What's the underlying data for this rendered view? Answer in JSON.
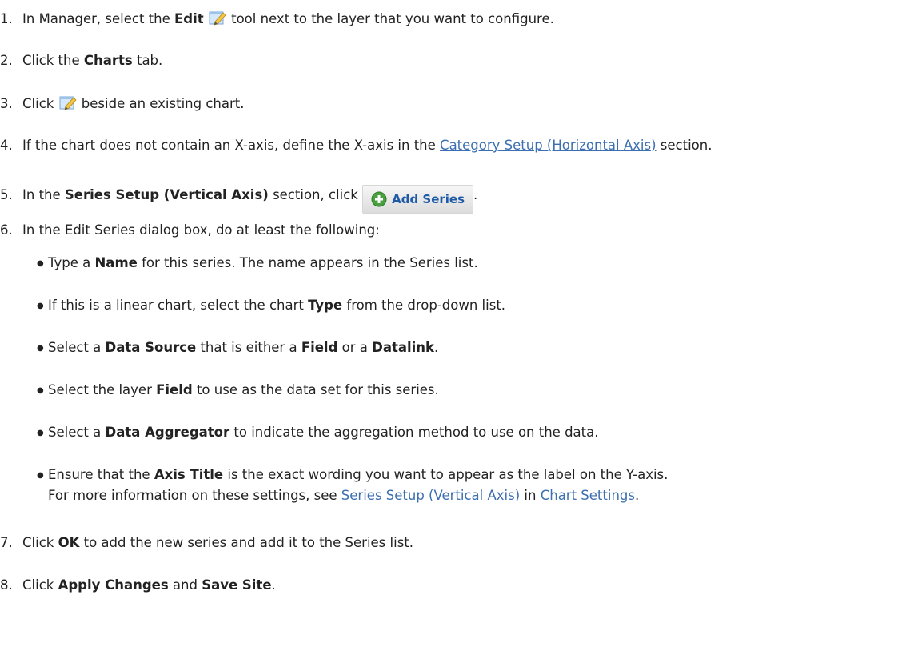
{
  "steps": [
    {
      "n": "1.",
      "a": "In Manager, select the ",
      "b": "Edit",
      "c": " tool next to the layer that you want to configure."
    },
    {
      "n": "2.",
      "a": "Click the ",
      "b": "Charts",
      "c": " tab."
    },
    {
      "n": "3.",
      "a": "Click ",
      "c": " beside an existing chart."
    },
    {
      "n": "4.",
      "a": "If the chart does not contain an X-axis, define the X-axis in the ",
      "link": "Category Setup (Horizontal Axis)",
      "c": " section."
    },
    {
      "n": "5.",
      "a": "In the ",
      "b": "Series Setup (Vertical Axis)",
      "c": " section, click ",
      "button": "Add Series",
      "d": "."
    },
    {
      "n": "6.",
      "a": "In the Edit Series dialog box, do at least the following:"
    },
    {
      "n": "7.",
      "a": "Click ",
      "b": "OK",
      "c": " to add the new series and add it to the Series list."
    },
    {
      "n": "8.",
      "a": "Click ",
      "b": "Apply Changes",
      "c": " and ",
      "b2": "Save Site",
      "d": "."
    }
  ],
  "bullets": [
    {
      "a": "Type a ",
      "b": "Name",
      "c": " for this series. The name appears in the Series list."
    },
    {
      "a": "If this is a linear chart, select the chart ",
      "b": "Type",
      "c": " from the drop-down list."
    },
    {
      "a": "Select a ",
      "b": "Data Source",
      "c": " that is either a ",
      "b2": "Field",
      "d": " or a ",
      "b3": "Datalink",
      "e": "."
    },
    {
      "a": "Select the layer ",
      "b": "Field",
      "c": " to use as the data set for this series."
    },
    {
      "a": "Select a ",
      "b": "Data Aggregator",
      "c": " to indicate the aggregation method to use on the data."
    },
    {
      "a": "Ensure that the ",
      "b": "Axis Title",
      "c": " is the exact wording you want to appear as the label on the Y-axis."
    }
  ],
  "bullet_cont": {
    "a": "For more information on these settings, see ",
    "link1": "Series Setup (Vertical Axis) ",
    "b": " in ",
    "link2": "Chart Settings",
    "c": "."
  },
  "bullet_glyph": "●",
  "icons": {
    "edit": "edit-pencil-icon",
    "add": "plus-circle-icon"
  },
  "colors": {
    "link": "#3c6fb1",
    "button_text": "#1f5aa6",
    "plus_green": "#4aa03f"
  }
}
